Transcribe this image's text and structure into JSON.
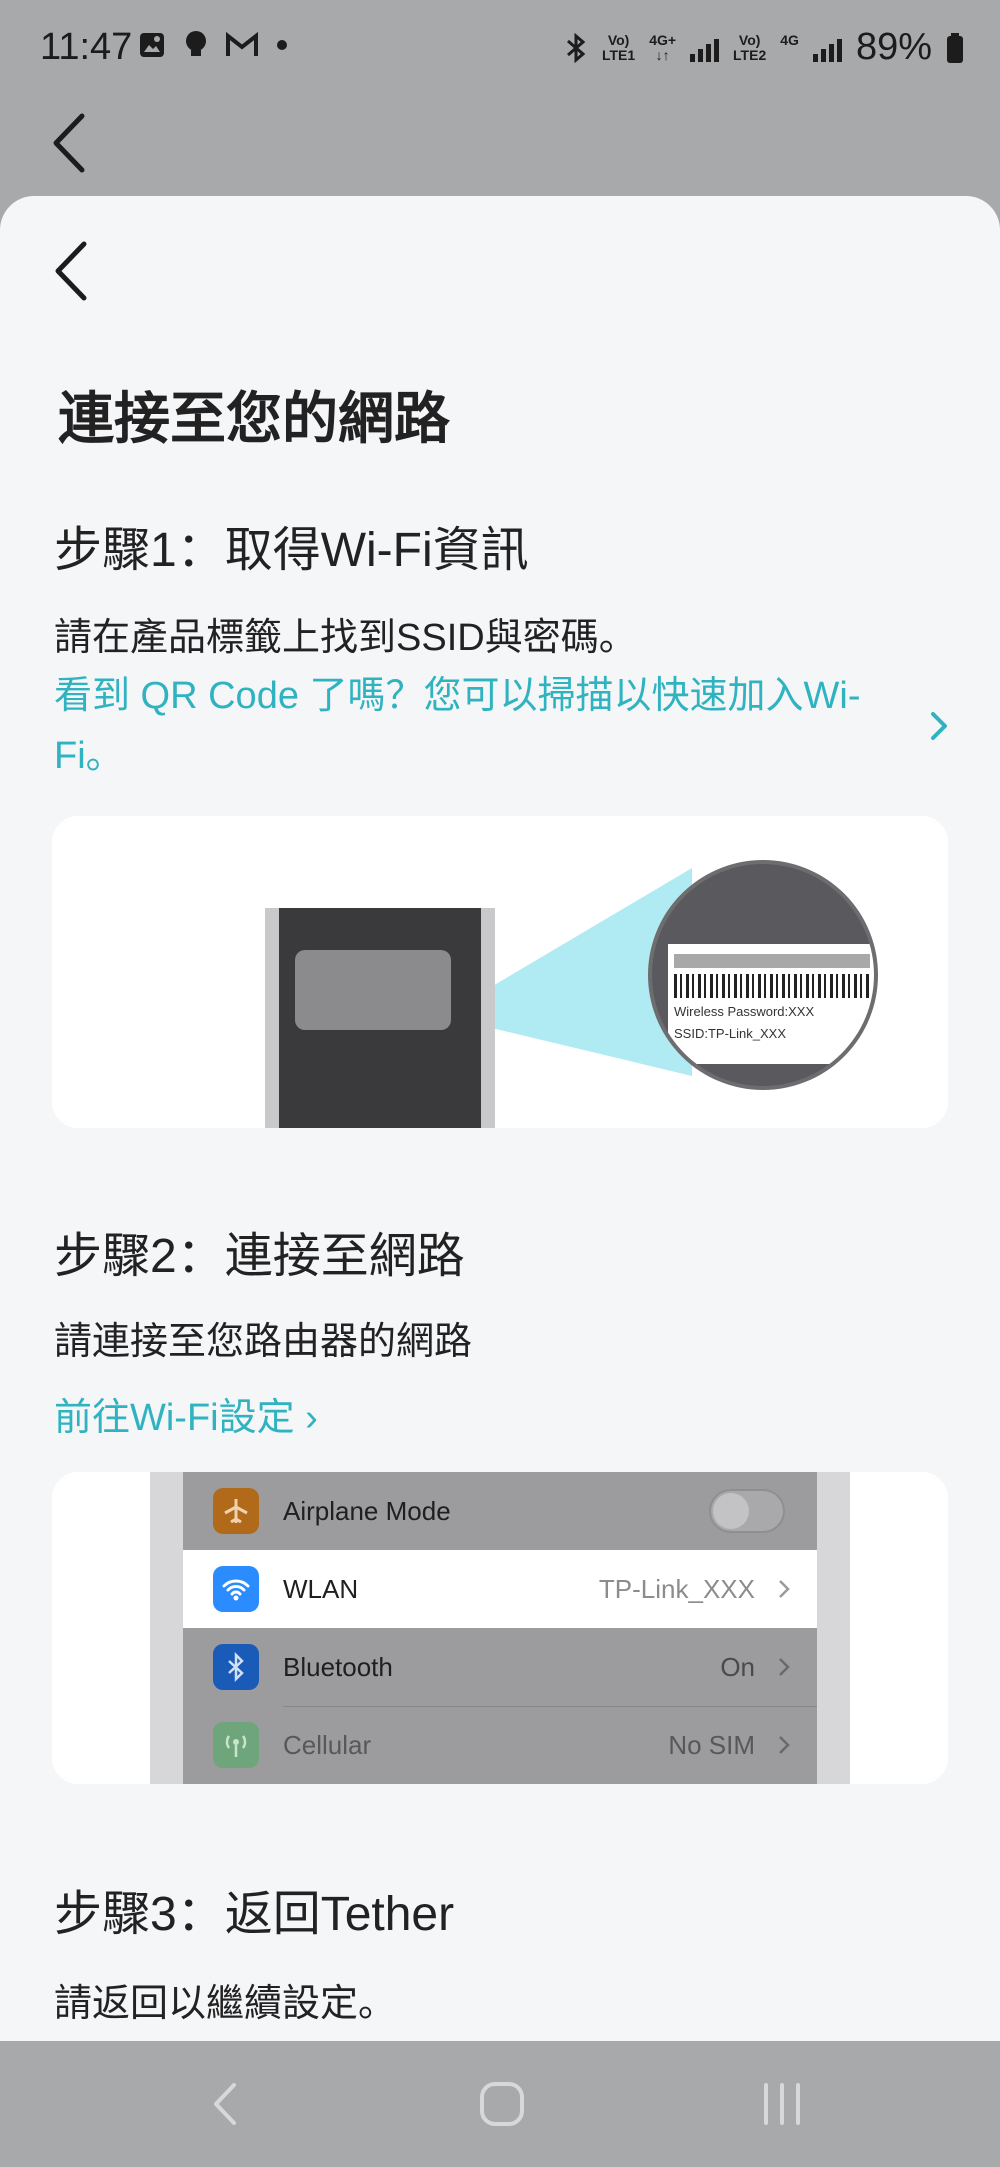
{
  "status_bar": {
    "time": "11:47",
    "sim1_top": "Vo)",
    "sim1_bottom": "LTE1",
    "net1": "4G+",
    "sim2_top": "Vo)",
    "sim2_bottom": "LTE2",
    "net2": "4G",
    "battery": "89%"
  },
  "page": {
    "title": "連接至您的網路"
  },
  "step1": {
    "title": "步驟1：取得Wi-Fi資訊",
    "desc": "請在產品標籤上找到SSID與密碼。",
    "qr_link": "看到 QR Code 了嗎？您可以掃描以快速加入Wi-Fi。",
    "label_password": "Wireless Password:XXX",
    "label_ssid": "SSID:TP-Link_XXX"
  },
  "step2": {
    "title": "步驟2：連接至網路",
    "desc": "請連接至您路由器的網路",
    "link": "前往Wi-Fi設定 ›",
    "settings": [
      {
        "name": "Airplane Mode",
        "value": ""
      },
      {
        "name": "WLAN",
        "value": "TP-Link_XXX"
      },
      {
        "name": "Bluetooth",
        "value": "On"
      },
      {
        "name": "Cellular",
        "value": "No SIM"
      }
    ]
  },
  "step3": {
    "title": "步驟3：返回Tether",
    "desc": "請返回以繼續設定。"
  },
  "colors": {
    "accent": "#2fb3c0",
    "sheet_bg": "#f5f6f8",
    "dim_bg": "#a8a9ab"
  }
}
